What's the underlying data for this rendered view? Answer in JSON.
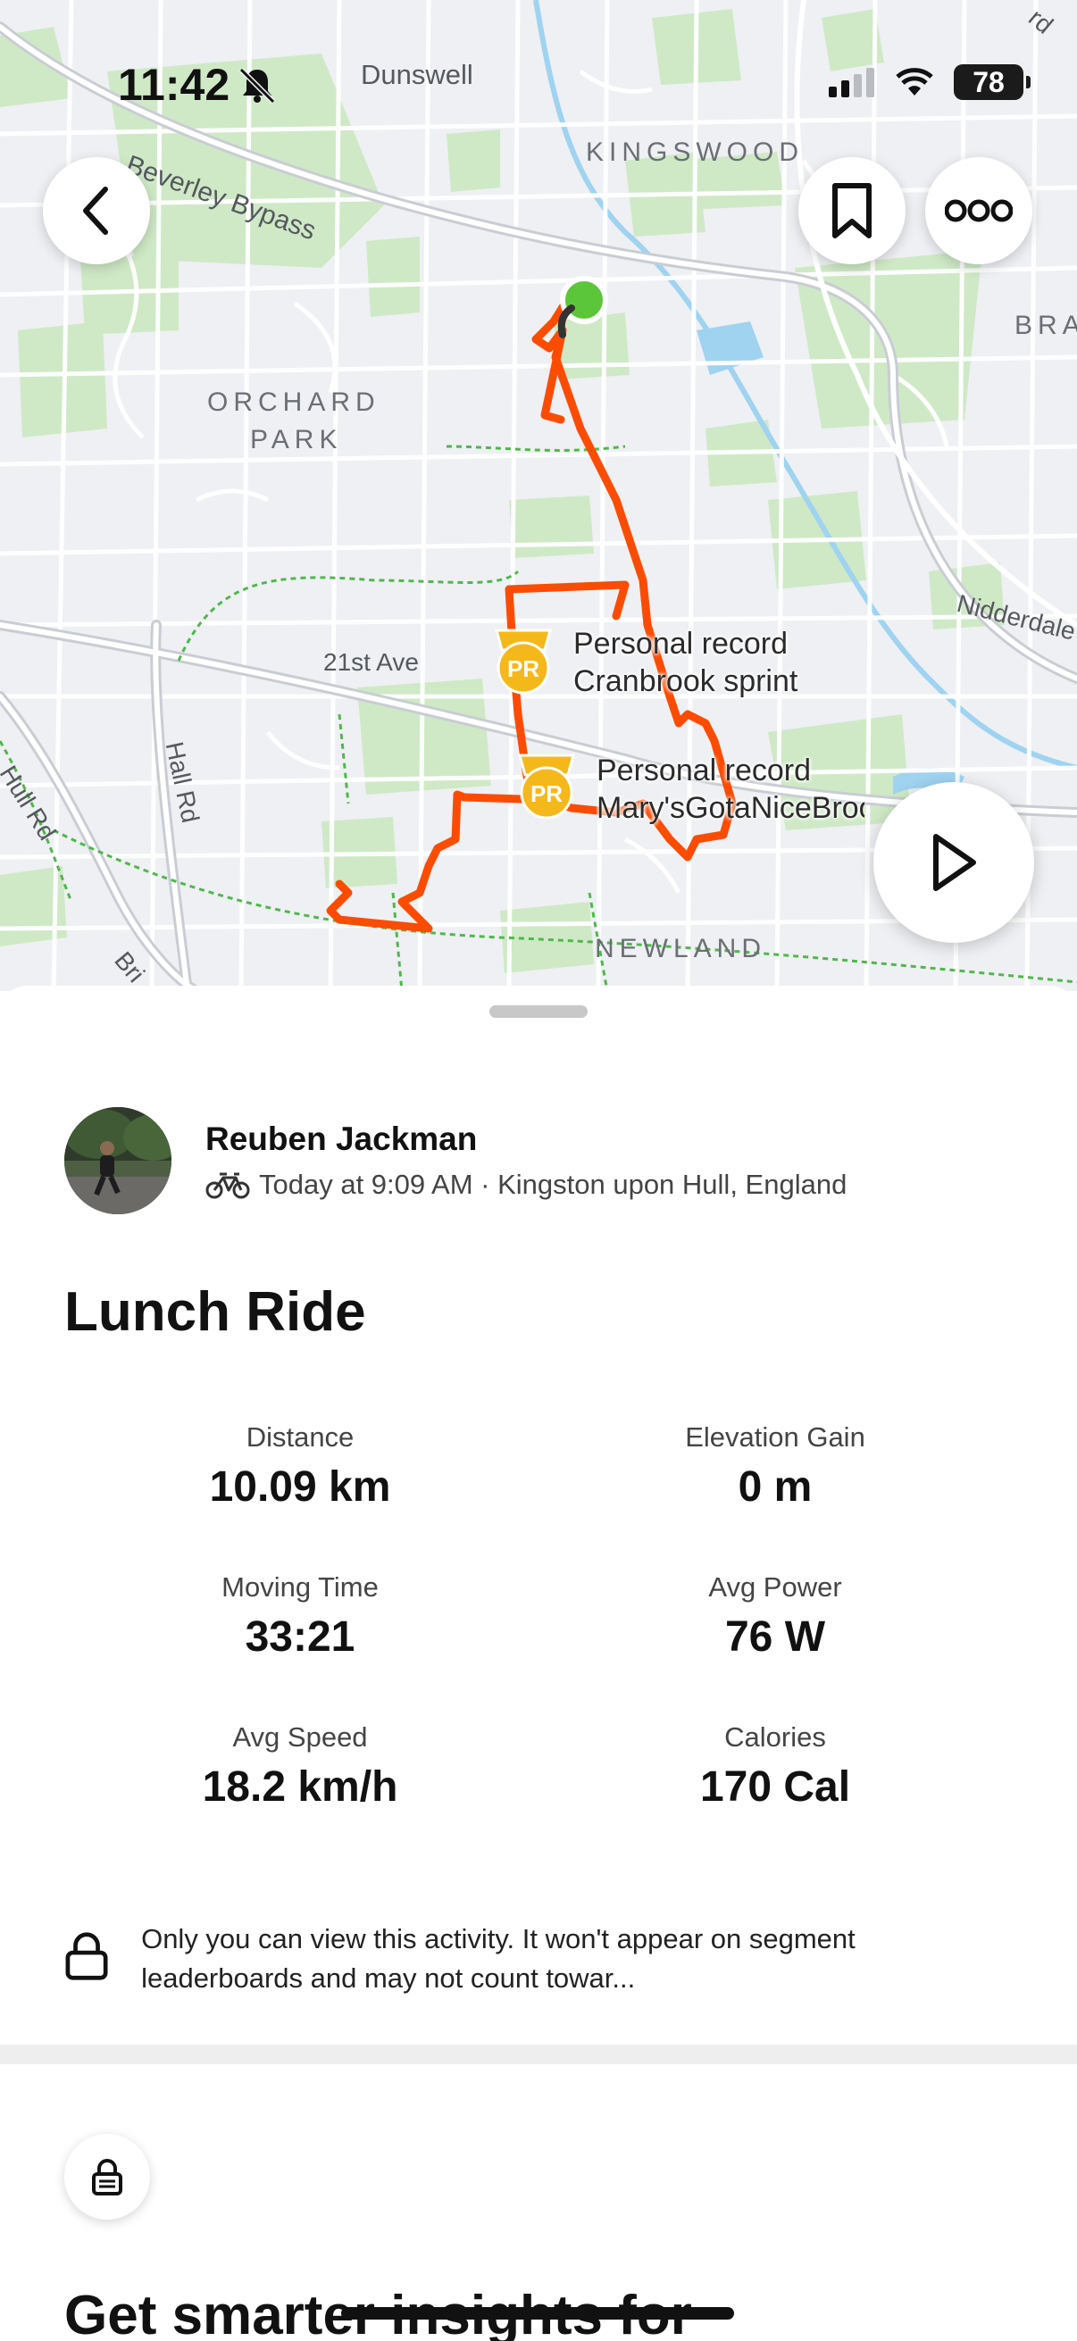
{
  "status_bar": {
    "time": "11:42",
    "battery": "78",
    "bell_icon": "bell-slash-icon",
    "signal_icon": "cellular-signal-icon",
    "wifi_icon": "wifi-icon"
  },
  "map": {
    "place_labels": [
      "KINGSWOOD",
      "ORCHARD",
      "PARK",
      "NEWLAND",
      "BRA"
    ],
    "road_labels": [
      "Dunswell",
      "Beverley Bypass",
      "21st Ave",
      "Hall Rd",
      "Hull Rd",
      "Nidderdale",
      "Bri",
      "rd"
    ],
    "segments": [
      {
        "line1": "Personal record",
        "line2": "Cranbrook sprint",
        "badge": "PR"
      },
      {
        "line1": "Personal record",
        "line2": "Mary'sGotaNiceBrook",
        "badge": "PR"
      }
    ],
    "route_color": "#fc4c02",
    "start_color": "#5cc63b"
  },
  "buttons": {
    "back_icon": "chevron-left-icon",
    "bookmark_icon": "bookmark-icon",
    "more_icon": "more-dots-icon",
    "play_icon": "play-icon"
  },
  "athlete": {
    "name": "Reuben Jackman",
    "meta": "Today at 9:09 AM · Kingston upon Hull, England",
    "sport_icon": "bike-icon"
  },
  "activity": {
    "title": "Lunch Ride",
    "stats": [
      {
        "label": "Distance",
        "value": "10.09 km"
      },
      {
        "label": "Elevation Gain",
        "value": "0 m"
      },
      {
        "label": "Moving Time",
        "value": "33:21"
      },
      {
        "label": "Avg Power",
        "value": "76 W"
      },
      {
        "label": "Avg Speed",
        "value": "18.2 km/h"
      },
      {
        "label": "Calories",
        "value": "170 Cal"
      }
    ],
    "privacy_notice": "Only you can view this activity. It won't appear on segment leaderboards and may not count towar..."
  },
  "insights": {
    "title": "Get smarter insights for",
    "lock_icon": "lock-icon"
  }
}
